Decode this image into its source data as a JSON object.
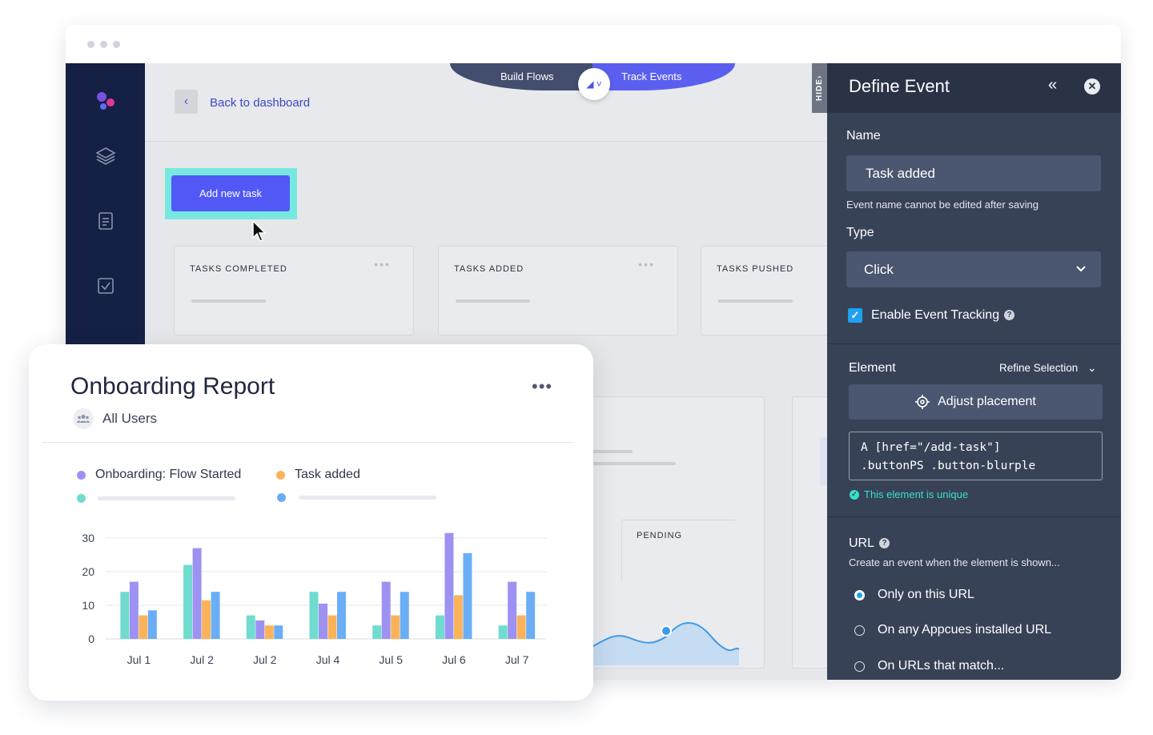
{
  "flows": {
    "build_label": "Build Flows",
    "track_label": "Track Events"
  },
  "topbar": {
    "back_label": "Back to dashboard",
    "hide_label": "HIDE"
  },
  "main": {
    "add_task_label": "Add new task",
    "stat_cards": [
      {
        "title": "TASKS COMPLETED"
      },
      {
        "title": "TASKS ADDED"
      },
      {
        "title": "TASKS PUSHED"
      }
    ],
    "pending_label": "PENDING"
  },
  "panel": {
    "title": "Define Event",
    "name_label": "Name",
    "name_value": "Task added",
    "name_hint": "Event name cannot be edited after saving",
    "type_label": "Type",
    "type_value": "Click",
    "tracking_label": "Enable Event Tracking",
    "element_label": "Element",
    "refine_label": "Refine Selection",
    "adjust_label": "Adjust placement",
    "selector_line1": "A [href=\"/add-task\"]",
    "selector_line2": ".buttonPS .button-blurple",
    "unique_label": "This element is unique",
    "url_label": "URL",
    "url_hint": "Create an event when the element is shown...",
    "url_options": [
      {
        "label": "Only on this URL",
        "selected": true
      },
      {
        "label": "On any Appcues installed URL",
        "selected": false
      },
      {
        "label": "On URLs that match...",
        "selected": false
      }
    ]
  },
  "report": {
    "title": "Onboarding Report",
    "audience": "All Users",
    "more_label": "•••"
  },
  "colors": {
    "teal": "#6fdccf",
    "purple": "#9d92f2",
    "orange": "#fbb35a",
    "blue": "#6aaef6",
    "accent": "#5158f6"
  },
  "chart_data": {
    "type": "bar",
    "categories": [
      "Jul 1",
      "Jul 2",
      "Jul 2",
      "Jul 4",
      "Jul 5",
      "Jul 6",
      "Jul 7"
    ],
    "series": [
      {
        "name": "Onboarding: Flow Started",
        "values": [
          14,
          22,
          7,
          14,
          4,
          7,
          4
        ]
      },
      {
        "values": [
          17,
          27,
          5.5,
          10.5,
          17,
          31.5,
          17
        ]
      },
      {
        "name": "Task added",
        "values": [
          7,
          11.5,
          4,
          7,
          7,
          13,
          7
        ]
      },
      {
        "values": [
          8.5,
          14,
          4,
          14,
          14,
          25.5,
          14
        ]
      }
    ],
    "ylim": [
      0,
      30
    ],
    "yticks": [
      0,
      10,
      20,
      30
    ],
    "grid": true
  }
}
